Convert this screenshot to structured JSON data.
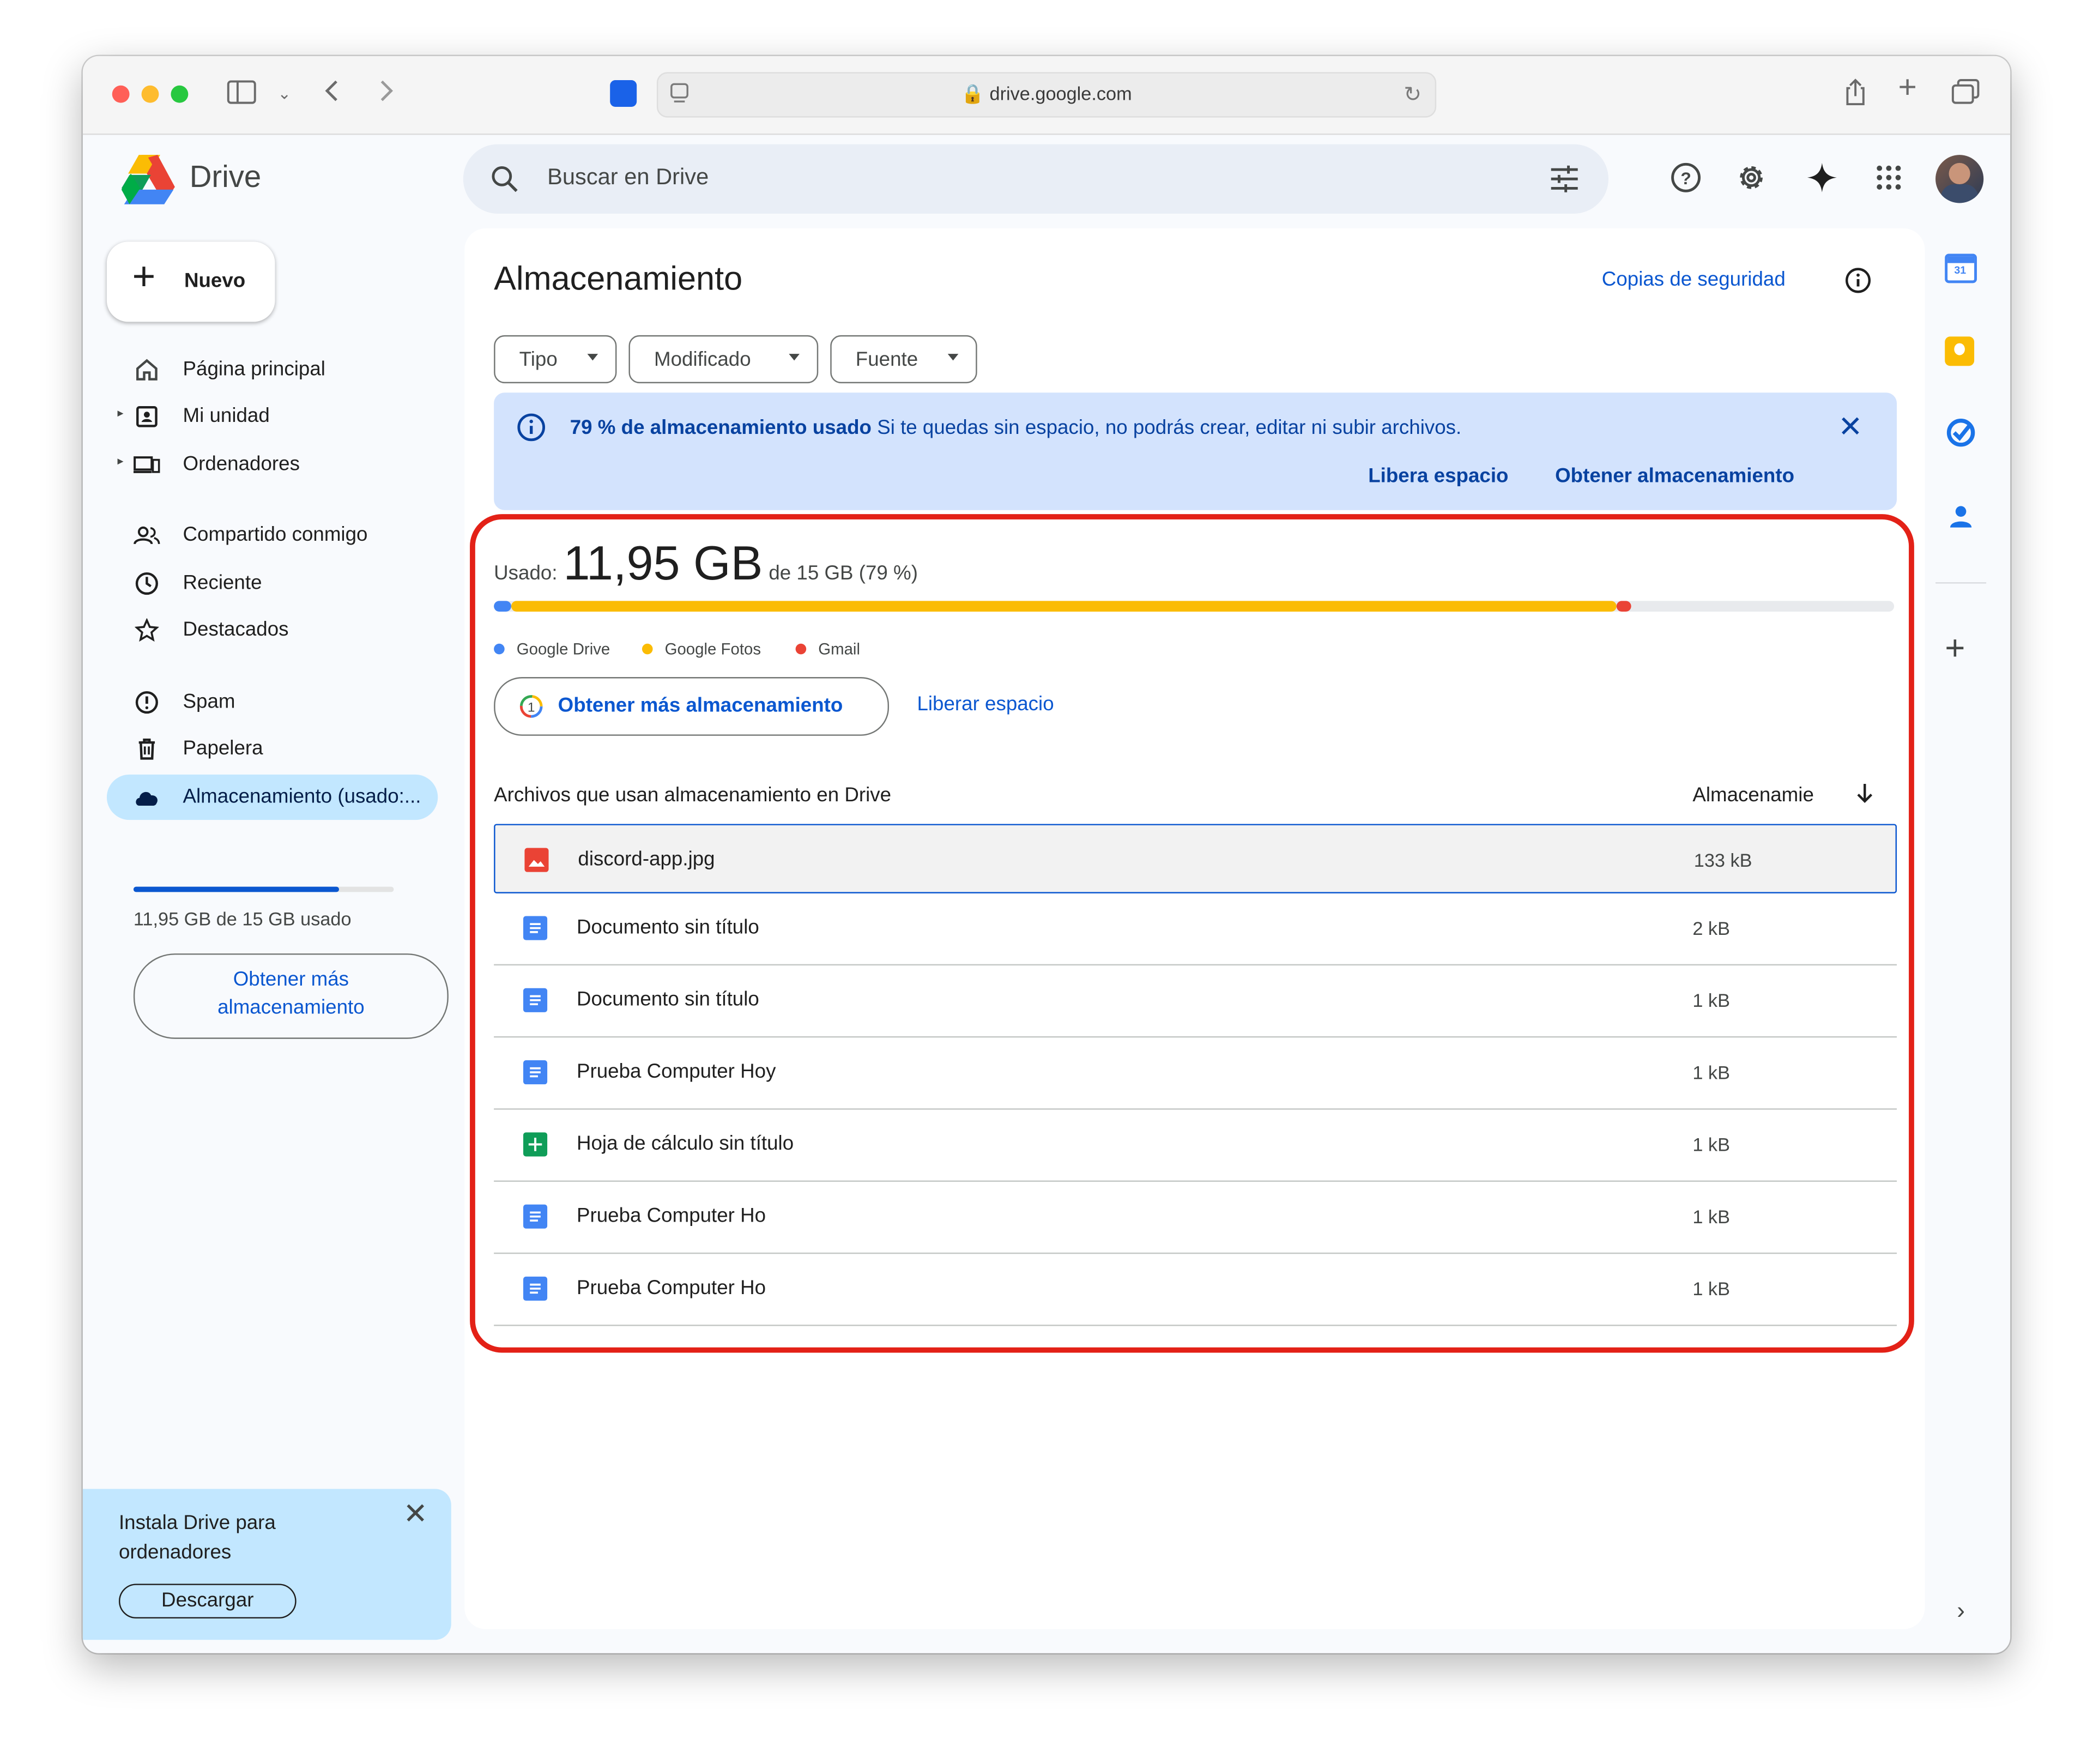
{
  "browser": {
    "url": "drive.google.com"
  },
  "app": {
    "name": "Drive"
  },
  "search": {
    "placeholder": "Buscar en Drive"
  },
  "sidebar": {
    "new_label": "Nuevo",
    "items": [
      {
        "label": "Página principal"
      },
      {
        "label": "Mi unidad"
      },
      {
        "label": "Ordenadores"
      },
      {
        "label": "Compartido conmigo"
      },
      {
        "label": "Reciente"
      },
      {
        "label": "Destacados"
      },
      {
        "label": "Spam"
      },
      {
        "label": "Papelera"
      },
      {
        "label": "Almacenamiento (usado:..."
      }
    ],
    "storage_fraction": 0.79,
    "storage_text": "11,95 GB de 15 GB usado",
    "get_more_line1": "Obtener más",
    "get_more_line2": "almacenamiento",
    "promo": {
      "text": "Instala Drive para ordenadores",
      "download": "Descargar"
    }
  },
  "main": {
    "title": "Almacenamiento",
    "backups_link": "Copias de seguridad",
    "filters": [
      "Tipo",
      "Modificado",
      "Fuente"
    ],
    "banner": {
      "bold": "79 % de almacenamiento usado",
      "text": " Si te quedas sin espacio, no podrás crear, editar ni subir archivos.",
      "action1": "Libera espacio",
      "action2": "Obtener almacenamiento"
    },
    "usage": {
      "label": "Usado:",
      "amount": "11,95 GB",
      "of": "de 15 GB (79 %)",
      "segments": [
        {
          "name": "Google Drive",
          "fraction": 0.012,
          "color": "#4285f4"
        },
        {
          "name": "Google Fotos",
          "fraction": 0.79,
          "color": "#fbbc04"
        },
        {
          "name": "Gmail",
          "fraction": 0.01,
          "color": "#ea4335"
        }
      ]
    },
    "get_more_button": "Obtener más almacenamiento",
    "free_space_link": "Liberar espacio",
    "table": {
      "header_name": "Archivos que usan almacenamiento en Drive",
      "header_size": "Almacenamie",
      "rows": [
        {
          "name": "discord-app.jpg",
          "size": "133 kB",
          "type": "image"
        },
        {
          "name": "Documento sin título",
          "size": "2 kB",
          "type": "doc"
        },
        {
          "name": "Documento sin título",
          "size": "1 kB",
          "type": "doc"
        },
        {
          "name": "Prueba Computer Hoy",
          "size": "1 kB",
          "type": "doc"
        },
        {
          "name": "Hoja de cálculo sin título",
          "size": "1 kB",
          "type": "sheet"
        },
        {
          "name": "Prueba Computer Ho",
          "size": "1 kB",
          "type": "doc"
        },
        {
          "name": "Prueba Computer Ho",
          "size": "1 kB",
          "type": "doc"
        }
      ]
    }
  },
  "colors": {
    "accent": "#0b57d0",
    "highlight": "#e32117",
    "banner": "#d3e3fd"
  }
}
